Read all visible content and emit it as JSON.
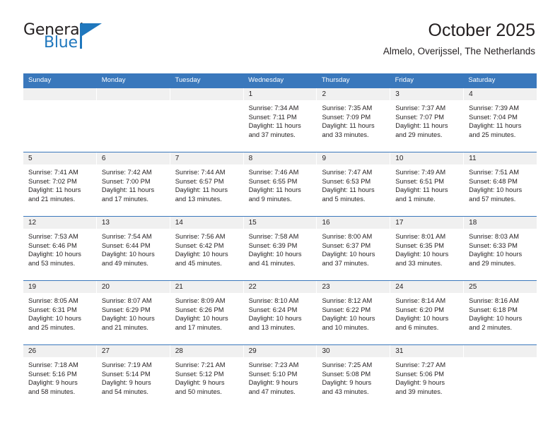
{
  "brand": {
    "line1": "General",
    "line2": "Blue",
    "triangle_icon": "brand-triangle-icon",
    "accent_color": "#1f77bd"
  },
  "header": {
    "title": "October 2025",
    "subtitle": "Almelo, Overijssel, The Netherlands"
  },
  "theme": {
    "header_blue": "#3a78bc",
    "band_gray": "#f0f0f0",
    "text": "#231f20"
  },
  "weekday_headers": [
    "Sunday",
    "Monday",
    "Tuesday",
    "Wednesday",
    "Thursday",
    "Friday",
    "Saturday"
  ],
  "weeks": [
    [
      {
        "day": "",
        "sunrise": "",
        "sunset": "",
        "daylight1": "",
        "daylight2": ""
      },
      {
        "day": "",
        "sunrise": "",
        "sunset": "",
        "daylight1": "",
        "daylight2": ""
      },
      {
        "day": "",
        "sunrise": "",
        "sunset": "",
        "daylight1": "",
        "daylight2": ""
      },
      {
        "day": "1",
        "sunrise": "Sunrise: 7:34 AM",
        "sunset": "Sunset: 7:11 PM",
        "daylight1": "Daylight: 11 hours",
        "daylight2": "and 37 minutes."
      },
      {
        "day": "2",
        "sunrise": "Sunrise: 7:35 AM",
        "sunset": "Sunset: 7:09 PM",
        "daylight1": "Daylight: 11 hours",
        "daylight2": "and 33 minutes."
      },
      {
        "day": "3",
        "sunrise": "Sunrise: 7:37 AM",
        "sunset": "Sunset: 7:07 PM",
        "daylight1": "Daylight: 11 hours",
        "daylight2": "and 29 minutes."
      },
      {
        "day": "4",
        "sunrise": "Sunrise: 7:39 AM",
        "sunset": "Sunset: 7:04 PM",
        "daylight1": "Daylight: 11 hours",
        "daylight2": "and 25 minutes."
      }
    ],
    [
      {
        "day": "5",
        "sunrise": "Sunrise: 7:41 AM",
        "sunset": "Sunset: 7:02 PM",
        "daylight1": "Daylight: 11 hours",
        "daylight2": "and 21 minutes."
      },
      {
        "day": "6",
        "sunrise": "Sunrise: 7:42 AM",
        "sunset": "Sunset: 7:00 PM",
        "daylight1": "Daylight: 11 hours",
        "daylight2": "and 17 minutes."
      },
      {
        "day": "7",
        "sunrise": "Sunrise: 7:44 AM",
        "sunset": "Sunset: 6:57 PM",
        "daylight1": "Daylight: 11 hours",
        "daylight2": "and 13 minutes."
      },
      {
        "day": "8",
        "sunrise": "Sunrise: 7:46 AM",
        "sunset": "Sunset: 6:55 PM",
        "daylight1": "Daylight: 11 hours",
        "daylight2": "and 9 minutes."
      },
      {
        "day": "9",
        "sunrise": "Sunrise: 7:47 AM",
        "sunset": "Sunset: 6:53 PM",
        "daylight1": "Daylight: 11 hours",
        "daylight2": "and 5 minutes."
      },
      {
        "day": "10",
        "sunrise": "Sunrise: 7:49 AM",
        "sunset": "Sunset: 6:51 PM",
        "daylight1": "Daylight: 11 hours",
        "daylight2": "and 1 minute."
      },
      {
        "day": "11",
        "sunrise": "Sunrise: 7:51 AM",
        "sunset": "Sunset: 6:48 PM",
        "daylight1": "Daylight: 10 hours",
        "daylight2": "and 57 minutes."
      }
    ],
    [
      {
        "day": "12",
        "sunrise": "Sunrise: 7:53 AM",
        "sunset": "Sunset: 6:46 PM",
        "daylight1": "Daylight: 10 hours",
        "daylight2": "and 53 minutes."
      },
      {
        "day": "13",
        "sunrise": "Sunrise: 7:54 AM",
        "sunset": "Sunset: 6:44 PM",
        "daylight1": "Daylight: 10 hours",
        "daylight2": "and 49 minutes."
      },
      {
        "day": "14",
        "sunrise": "Sunrise: 7:56 AM",
        "sunset": "Sunset: 6:42 PM",
        "daylight1": "Daylight: 10 hours",
        "daylight2": "and 45 minutes."
      },
      {
        "day": "15",
        "sunrise": "Sunrise: 7:58 AM",
        "sunset": "Sunset: 6:39 PM",
        "daylight1": "Daylight: 10 hours",
        "daylight2": "and 41 minutes."
      },
      {
        "day": "16",
        "sunrise": "Sunrise: 8:00 AM",
        "sunset": "Sunset: 6:37 PM",
        "daylight1": "Daylight: 10 hours",
        "daylight2": "and 37 minutes."
      },
      {
        "day": "17",
        "sunrise": "Sunrise: 8:01 AM",
        "sunset": "Sunset: 6:35 PM",
        "daylight1": "Daylight: 10 hours",
        "daylight2": "and 33 minutes."
      },
      {
        "day": "18",
        "sunrise": "Sunrise: 8:03 AM",
        "sunset": "Sunset: 6:33 PM",
        "daylight1": "Daylight: 10 hours",
        "daylight2": "and 29 minutes."
      }
    ],
    [
      {
        "day": "19",
        "sunrise": "Sunrise: 8:05 AM",
        "sunset": "Sunset: 6:31 PM",
        "daylight1": "Daylight: 10 hours",
        "daylight2": "and 25 minutes."
      },
      {
        "day": "20",
        "sunrise": "Sunrise: 8:07 AM",
        "sunset": "Sunset: 6:29 PM",
        "daylight1": "Daylight: 10 hours",
        "daylight2": "and 21 minutes."
      },
      {
        "day": "21",
        "sunrise": "Sunrise: 8:09 AM",
        "sunset": "Sunset: 6:26 PM",
        "daylight1": "Daylight: 10 hours",
        "daylight2": "and 17 minutes."
      },
      {
        "day": "22",
        "sunrise": "Sunrise: 8:10 AM",
        "sunset": "Sunset: 6:24 PM",
        "daylight1": "Daylight: 10 hours",
        "daylight2": "and 13 minutes."
      },
      {
        "day": "23",
        "sunrise": "Sunrise: 8:12 AM",
        "sunset": "Sunset: 6:22 PM",
        "daylight1": "Daylight: 10 hours",
        "daylight2": "and 10 minutes."
      },
      {
        "day": "24",
        "sunrise": "Sunrise: 8:14 AM",
        "sunset": "Sunset: 6:20 PM",
        "daylight1": "Daylight: 10 hours",
        "daylight2": "and 6 minutes."
      },
      {
        "day": "25",
        "sunrise": "Sunrise: 8:16 AM",
        "sunset": "Sunset: 6:18 PM",
        "daylight1": "Daylight: 10 hours",
        "daylight2": "and 2 minutes."
      }
    ],
    [
      {
        "day": "26",
        "sunrise": "Sunrise: 7:18 AM",
        "sunset": "Sunset: 5:16 PM",
        "daylight1": "Daylight: 9 hours",
        "daylight2": "and 58 minutes."
      },
      {
        "day": "27",
        "sunrise": "Sunrise: 7:19 AM",
        "sunset": "Sunset: 5:14 PM",
        "daylight1": "Daylight: 9 hours",
        "daylight2": "and 54 minutes."
      },
      {
        "day": "28",
        "sunrise": "Sunrise: 7:21 AM",
        "sunset": "Sunset: 5:12 PM",
        "daylight1": "Daylight: 9 hours",
        "daylight2": "and 50 minutes."
      },
      {
        "day": "29",
        "sunrise": "Sunrise: 7:23 AM",
        "sunset": "Sunset: 5:10 PM",
        "daylight1": "Daylight: 9 hours",
        "daylight2": "and 47 minutes."
      },
      {
        "day": "30",
        "sunrise": "Sunrise: 7:25 AM",
        "sunset": "Sunset: 5:08 PM",
        "daylight1": "Daylight: 9 hours",
        "daylight2": "and 43 minutes."
      },
      {
        "day": "31",
        "sunrise": "Sunrise: 7:27 AM",
        "sunset": "Sunset: 5:06 PM",
        "daylight1": "Daylight: 9 hours",
        "daylight2": "and 39 minutes."
      },
      {
        "day": "",
        "sunrise": "",
        "sunset": "",
        "daylight1": "",
        "daylight2": ""
      }
    ]
  ]
}
